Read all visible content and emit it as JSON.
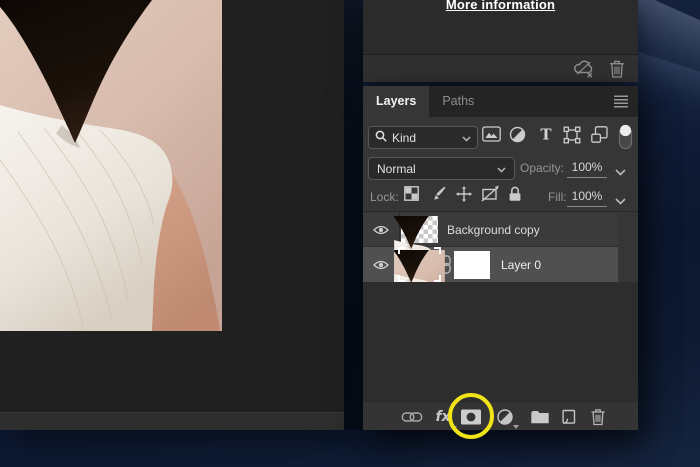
{
  "info_panel": {
    "link_label": "More information",
    "icons": [
      "cloud-sync-disabled-icon",
      "delete-icon"
    ]
  },
  "layers_panel": {
    "tabs": [
      {
        "label": "Layers",
        "active": true
      },
      {
        "label": "Paths",
        "active": false
      }
    ],
    "menu_icon": "panel-menu-icon",
    "filter_bar": {
      "search_label": "Kind",
      "type_filter_glyph": "T",
      "filter_types": [
        "pixel-layers",
        "adjustment-layers",
        "type-layers",
        "shape-layers",
        "smart-objects"
      ],
      "filter_toggle_on": true
    },
    "blend_bar": {
      "blend_mode": "Normal",
      "opacity_label": "Opacity:",
      "opacity_value": "100%"
    },
    "lock_bar": {
      "label": "Lock:",
      "lock_types": [
        "transparent-pixels",
        "image-pixels",
        "position",
        "artboards",
        "all"
      ],
      "fill_label": "Fill:",
      "fill_value": "100%"
    },
    "layers": [
      {
        "name": "Background copy",
        "visible": true,
        "selected": false,
        "thumbnail": "person-on-transparency"
      },
      {
        "name": "Layer 0",
        "visible": true,
        "selected": true,
        "thumbnail": "photo",
        "mask": "white-mask",
        "mask_linked": true
      }
    ],
    "footer": {
      "fx_label": "fx",
      "icons": [
        "link-layers",
        "layer-styles",
        "add-layer-mask",
        "adjustment-fill-layer",
        "new-group",
        "new-layer",
        "delete-layer"
      ]
    },
    "annotation": {
      "shape": "circle",
      "color": "#f0e418",
      "target": "add-layer-mask"
    }
  },
  "colors": {
    "annotation_yellow": "#f0e418",
    "panel_bg": "#363636",
    "selected_row": "#505050",
    "desktop_navy": "#101d38",
    "canvas_bg": "#202020"
  }
}
